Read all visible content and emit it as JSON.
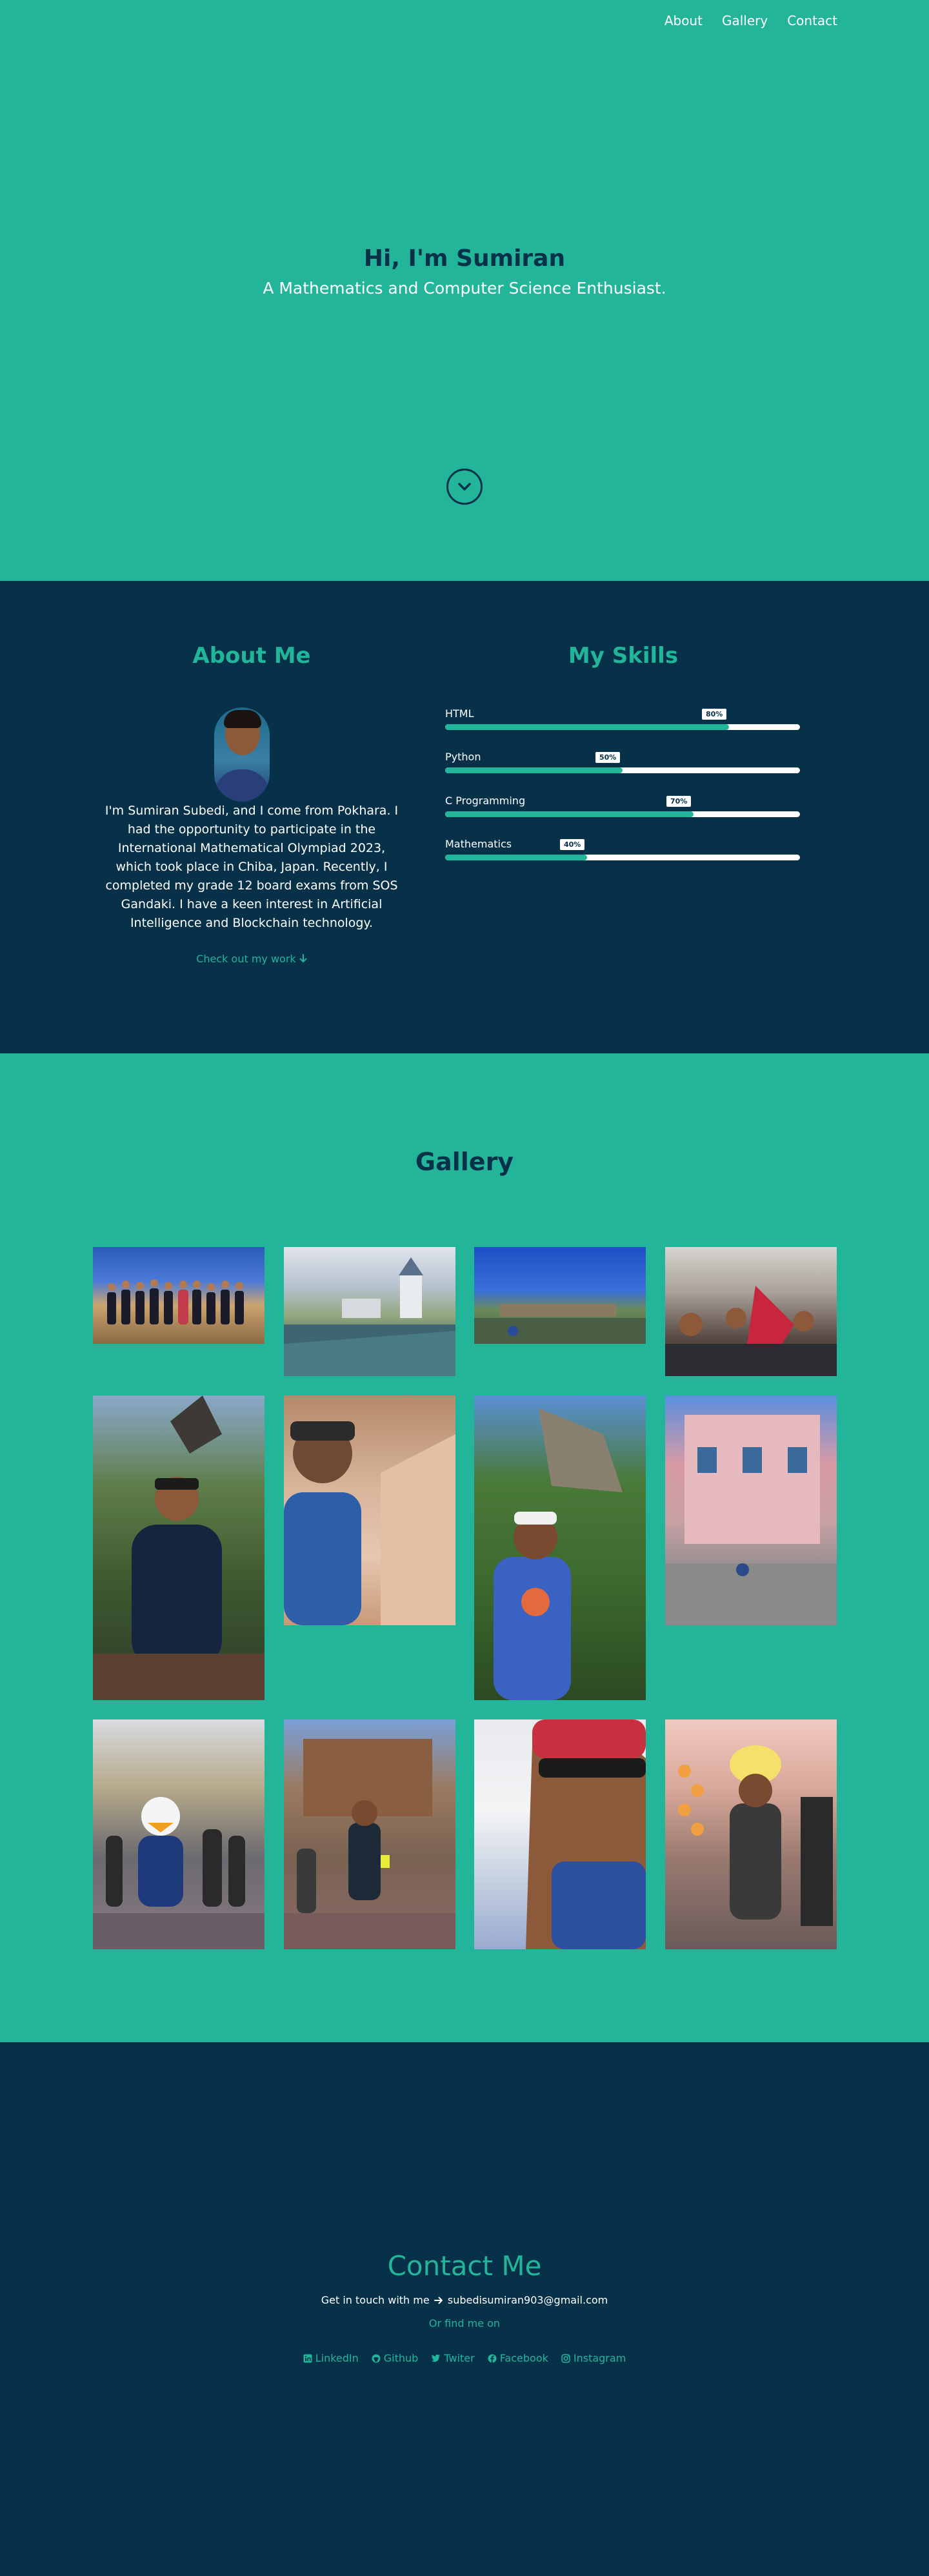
{
  "nav": {
    "items": [
      {
        "label": "About"
      },
      {
        "label": "Gallery"
      },
      {
        "label": "Contact"
      }
    ]
  },
  "hero": {
    "title": "Hi, I'm Sumiran",
    "subtitle": "A Mathematics and Computer Science Enthusiast.",
    "scroll_icon": "chevron-down-circle-icon"
  },
  "about": {
    "heading": "About Me",
    "text": "I'm Sumiran Subedi, and I come from Pokhara. I had the opportunity to participate in the International Mathematical Olympiad 2023, which took place in Chiba, Japan. Recently, I completed my grade 12 board exams from SOS Gandaki. I have a keen interest in Artificial Intelligence and Blockchain technology.",
    "work_link": "Check out my work",
    "work_icon": "arrow-down-icon"
  },
  "skills": {
    "heading": "My Skills",
    "items": [
      {
        "name": "HTML",
        "value": 0.8,
        "badge": "80%"
      },
      {
        "name": "Python",
        "value": 0.5,
        "badge": "50%"
      },
      {
        "name": "C Programming",
        "value": 0.7,
        "badge": "70%"
      },
      {
        "name": "Mathematics",
        "value": 0.4,
        "badge": "40%"
      }
    ]
  },
  "gallery": {
    "heading": "Gallery"
  },
  "contact": {
    "heading": "Contact Me",
    "prefix": "Get in touch with me",
    "email": "subedisumiran903@gmail.com",
    "find": "Or find me on",
    "socials": [
      {
        "label": "LinkedIn",
        "icon": "linkedin-icon"
      },
      {
        "label": "Github",
        "icon": "github-icon"
      },
      {
        "label": "Twiter",
        "icon": "twitter-icon"
      },
      {
        "label": "Facebook",
        "icon": "facebook-icon"
      },
      {
        "label": "Instagram",
        "icon": "instagram-icon"
      }
    ]
  },
  "colors": {
    "primary": "#22b59a",
    "dark": "#073148",
    "white": "#ffffff"
  }
}
